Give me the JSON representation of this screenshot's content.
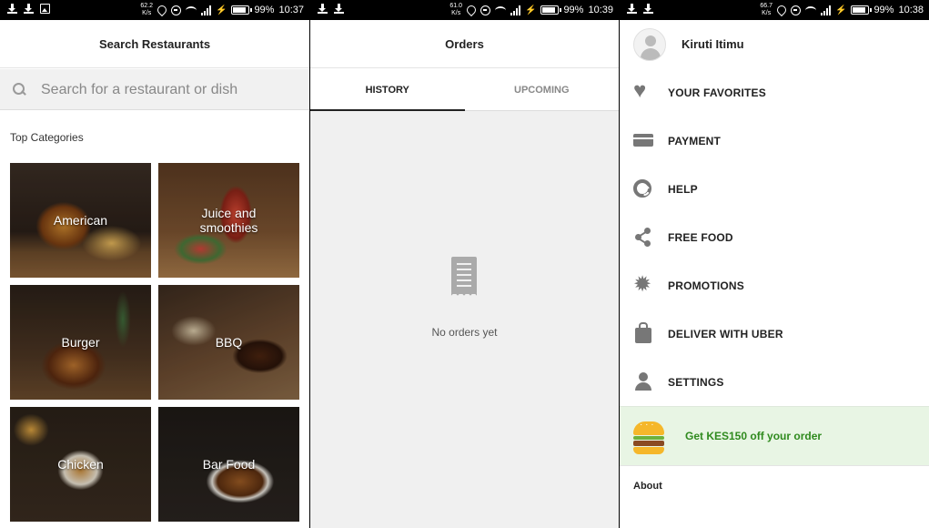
{
  "screens": [
    {
      "status": {
        "speed_value": "62.2",
        "speed_unit": "K/s",
        "battery": "99%",
        "time": "10:37"
      },
      "title": "Search Restaurants",
      "search": {
        "placeholder": "Search for a restaurant or dish"
      },
      "section_title": "Top Categories",
      "categories": [
        {
          "label": "American"
        },
        {
          "label": "Juice and smoothies"
        },
        {
          "label": "Burger"
        },
        {
          "label": "BBQ"
        },
        {
          "label": "Chicken"
        },
        {
          "label": "Bar Food"
        }
      ]
    },
    {
      "status": {
        "speed_value": "61.0",
        "speed_unit": "K/s",
        "battery": "99%",
        "time": "10:39"
      },
      "title": "Orders",
      "tabs": [
        {
          "label": "HISTORY",
          "active": true
        },
        {
          "label": "UPCOMING",
          "active": false
        }
      ],
      "empty_message": "No orders yet",
      "empty_icon": "receipt-icon"
    },
    {
      "status": {
        "speed_value": "66.7",
        "speed_unit": "K/s",
        "battery": "99%",
        "time": "10:38"
      },
      "profile_name": "Kiruti Itimu",
      "menu": [
        {
          "label": "YOUR FAVORITES",
          "icon": "heart-icon"
        },
        {
          "label": "PAYMENT",
          "icon": "card-icon"
        },
        {
          "label": "HELP",
          "icon": "lifebuoy-icon"
        },
        {
          "label": "FREE FOOD",
          "icon": "share-icon"
        },
        {
          "label": "PROMOTIONS",
          "icon": "badge-icon"
        },
        {
          "label": "DELIVER WITH UBER",
          "icon": "bag-icon"
        },
        {
          "label": "SETTINGS",
          "icon": "person-icon"
        }
      ],
      "promo": {
        "text": "Get KES150 off your order",
        "icon": "burger-icon",
        "color": "#2f8a1e",
        "background": "#e8f5e4"
      },
      "footer_link": "About"
    }
  ]
}
